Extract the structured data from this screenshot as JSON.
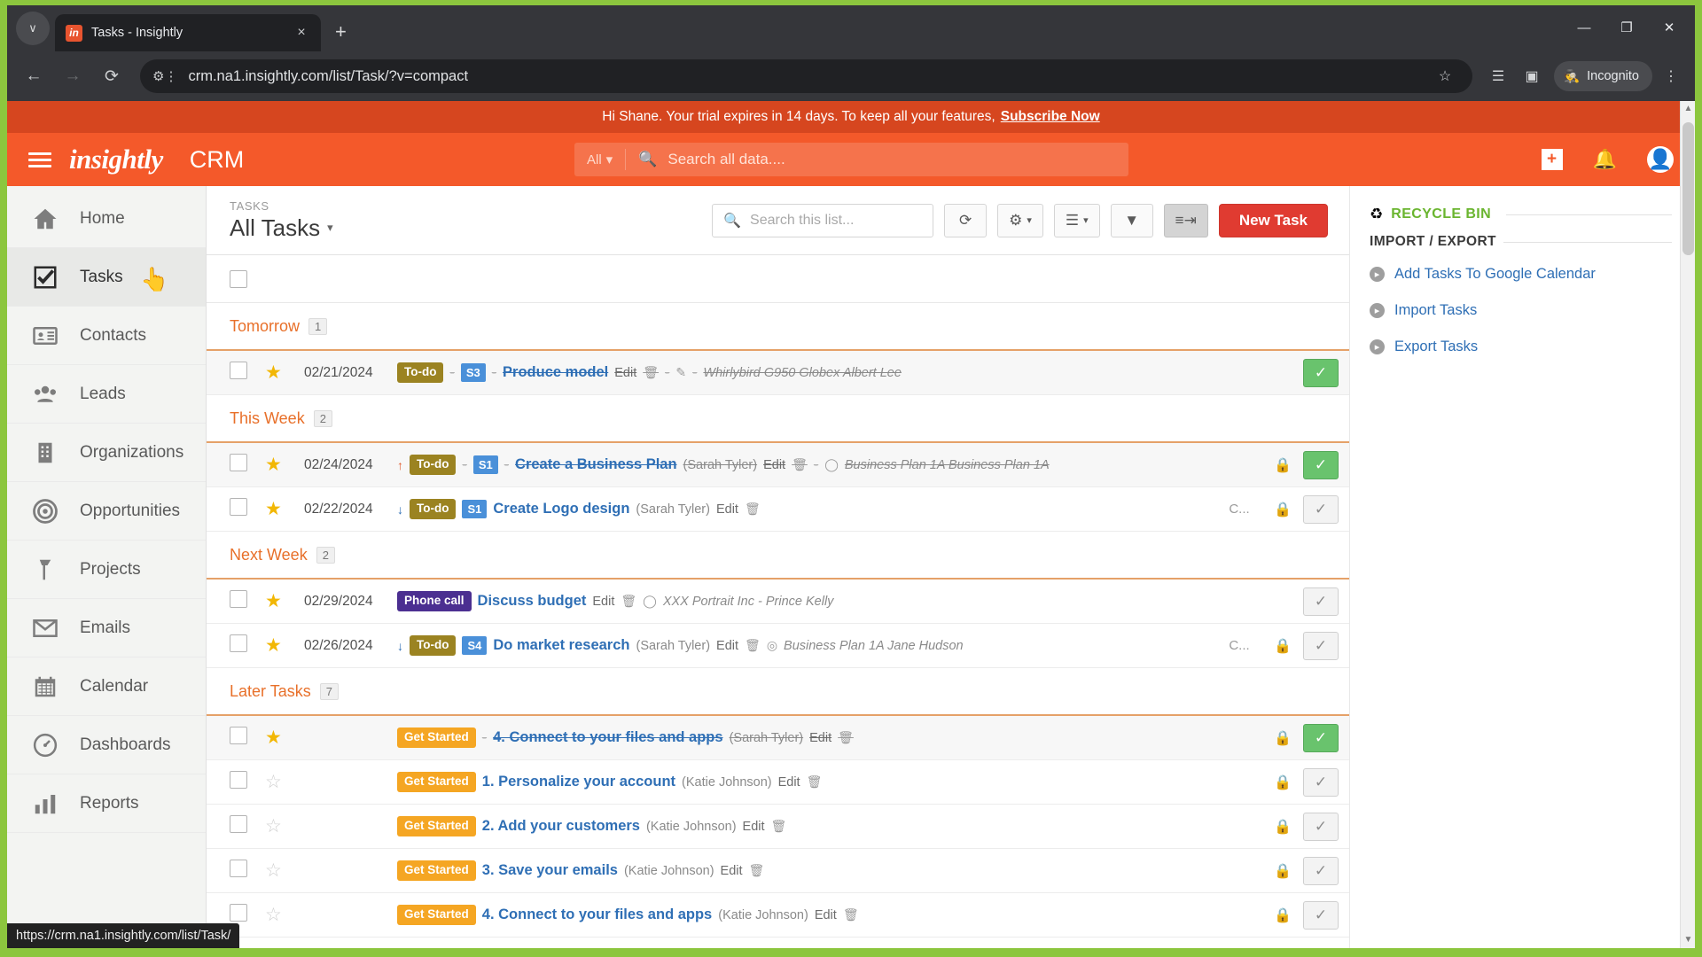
{
  "browser": {
    "tab": {
      "title": "Tasks - Insightly",
      "favicon_text": "in",
      "close_label": "×"
    },
    "new_tab_label": "+",
    "tab_list_chevron": "∨",
    "window": {
      "minimize": "—",
      "maximize": "❐",
      "close": "✕"
    },
    "nav": {
      "back": "←",
      "forward": "→",
      "reload": "⟳"
    },
    "url": "crm.na1.insightly.com/list/Task/?v=compact",
    "site_info_icon": "site-settings-icon",
    "actions": {
      "bookmark": "☆",
      "reading_list": "☰",
      "side_panel": "▣",
      "menu": "⋮"
    },
    "profile_label": "Incognito",
    "status_url": "https://crm.na1.insightly.com/list/Task/"
  },
  "trial": {
    "message": "Hi Shane. Your trial expires in 14 days. To keep all your features,",
    "cta": "Subscribe Now"
  },
  "appbar": {
    "brand": "insightly",
    "product": "CRM",
    "search_scope": "All",
    "search_placeholder": "Search all data....",
    "add_label": "+",
    "notifications_label": "notifications-bell",
    "account_label": "account-avatar"
  },
  "sidebar": {
    "items": [
      {
        "label": "Home",
        "icon": "home-icon",
        "active": false
      },
      {
        "label": "Tasks",
        "icon": "tasks-icon",
        "active": true
      },
      {
        "label": "Contacts",
        "icon": "contacts-icon",
        "active": false
      },
      {
        "label": "Leads",
        "icon": "leads-icon",
        "active": false
      },
      {
        "label": "Organizations",
        "icon": "organizations-icon",
        "active": false
      },
      {
        "label": "Opportunities",
        "icon": "opportunities-icon",
        "active": false
      },
      {
        "label": "Projects",
        "icon": "projects-icon",
        "active": false
      },
      {
        "label": "Emails",
        "icon": "emails-icon",
        "active": false
      },
      {
        "label": "Calendar",
        "icon": "calendar-icon",
        "active": false
      },
      {
        "label": "Dashboards",
        "icon": "dashboards-icon",
        "active": false
      },
      {
        "label": "Reports",
        "icon": "reports-icon",
        "active": false
      }
    ]
  },
  "toolbar": {
    "kicker": "TASKS",
    "view_name": "All Tasks",
    "view_caret": "▾",
    "search_placeholder": "Search this list...",
    "refresh_icon": "refresh-icon",
    "settings_icon": "gear-icon",
    "columns_icon": "list-view-icon",
    "filter_icon": "filter-icon",
    "sort_icon": "sort-icon",
    "new_task_label": "New Task"
  },
  "groups": [
    {
      "name": "Tomorrow",
      "count": "1",
      "tasks": [
        {
          "shaded": true,
          "starred": true,
          "date": "02/21/2024",
          "priority": "",
          "badge": {
            "label": "To-do",
            "type": "todo"
          },
          "stage": "S3",
          "title": "Produce model",
          "owner": "",
          "edit": "Edit",
          "related": "Whirlybird G950   Globex   Albert Lee",
          "completed": true,
          "cycle": "",
          "locked": false,
          "check_state": "green"
        }
      ]
    },
    {
      "name": "This Week",
      "count": "2",
      "tasks": [
        {
          "shaded": true,
          "starred": true,
          "date": "02/24/2024",
          "priority": "up",
          "badge": {
            "label": "To-do",
            "type": "todo"
          },
          "stage": "S1",
          "title": "Create a Business Plan",
          "owner": "(Sarah Tyler)",
          "edit": "Edit",
          "related": "Business Plan 1A    Business Plan 1A",
          "completed": true,
          "cycle": "",
          "locked": true,
          "check_state": "green"
        },
        {
          "shaded": false,
          "starred": true,
          "date": "02/22/2024",
          "priority": "down",
          "badge": {
            "label": "To-do",
            "type": "todo"
          },
          "stage": "S1",
          "title": "Create Logo design",
          "owner": "(Sarah Tyler)",
          "edit": "Edit",
          "related": "",
          "completed": false,
          "cycle": "C...",
          "locked": true,
          "check_state": "grey"
        }
      ]
    },
    {
      "name": "Next Week",
      "count": "2",
      "tasks": [
        {
          "shaded": false,
          "starred": true,
          "date": "02/29/2024",
          "priority": "",
          "badge": {
            "label": "Phone call",
            "type": "phone"
          },
          "stage": "",
          "title": "Discuss budget",
          "owner": "",
          "edit": "Edit",
          "related": "XXX Portrait Inc - Prince Kelly",
          "completed": false,
          "cycle": "",
          "locked": false,
          "check_state": "grey"
        },
        {
          "shaded": false,
          "starred": true,
          "date": "02/26/2024",
          "priority": "down",
          "badge": {
            "label": "To-do",
            "type": "todo"
          },
          "stage": "S4",
          "title": "Do market research",
          "owner": "(Sarah Tyler)",
          "edit": "Edit",
          "related": "Business Plan 1A    Jane Hudson",
          "completed": false,
          "cycle": "C...",
          "locked": true,
          "check_state": "grey"
        }
      ]
    },
    {
      "name": "Later Tasks",
      "count": "7",
      "tasks": [
        {
          "shaded": true,
          "starred": true,
          "date": "",
          "priority": "",
          "badge": {
            "label": "Get Started",
            "type": "getstarted"
          },
          "stage": "",
          "title": "4. Connect to your files and apps",
          "owner": "(Sarah Tyler)",
          "edit": "Edit",
          "related": "",
          "completed": true,
          "cycle": "",
          "locked": true,
          "check_state": "green"
        },
        {
          "shaded": false,
          "starred": false,
          "date": "",
          "priority": "",
          "badge": {
            "label": "Get Started",
            "type": "getstarted"
          },
          "stage": "",
          "title": "1. Personalize your account",
          "owner": "(Katie Johnson)",
          "edit": "Edit",
          "related": "",
          "completed": false,
          "cycle": "",
          "locked": true,
          "check_state": "grey"
        },
        {
          "shaded": false,
          "starred": false,
          "date": "",
          "priority": "",
          "badge": {
            "label": "Get Started",
            "type": "getstarted"
          },
          "stage": "",
          "title": "2. Add your customers",
          "owner": "(Katie Johnson)",
          "edit": "Edit",
          "related": "",
          "completed": false,
          "cycle": "",
          "locked": true,
          "check_state": "grey"
        },
        {
          "shaded": false,
          "starred": false,
          "date": "",
          "priority": "",
          "badge": {
            "label": "Get Started",
            "type": "getstarted"
          },
          "stage": "",
          "title": "3. Save your emails",
          "owner": "(Katie Johnson)",
          "edit": "Edit",
          "related": "",
          "completed": false,
          "cycle": "",
          "locked": true,
          "check_state": "grey"
        },
        {
          "shaded": false,
          "starred": false,
          "date": "",
          "priority": "",
          "badge": {
            "label": "Get Started",
            "type": "getstarted"
          },
          "stage": "",
          "title": "4. Connect to your files and apps",
          "owner": "(Katie Johnson)",
          "edit": "Edit",
          "related": "",
          "completed": false,
          "cycle": "",
          "locked": true,
          "check_state": "grey"
        }
      ]
    }
  ],
  "rightpanel": {
    "recycle_bin": "RECYCLE BIN",
    "import_export": "IMPORT / EXPORT",
    "links": [
      "Add Tasks To Google Calendar",
      "Import Tasks",
      "Export Tasks"
    ]
  },
  "colors": {
    "brand_orange": "#f4592a",
    "trial_bar": "#d6461f",
    "new_task_red": "#e03b31",
    "group_orange": "#e8702a",
    "link_blue": "#2f6fb5",
    "capture_green": "#8CC63E"
  }
}
